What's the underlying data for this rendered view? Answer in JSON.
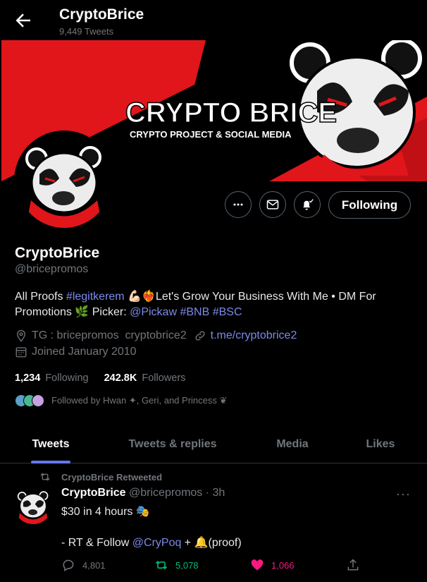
{
  "header": {
    "title": "CryptoBrice",
    "tweet_count": "9,449 Tweets"
  },
  "banner": {
    "headline": "CRYPTO BRICE",
    "tagline": "CRYPTO PROJECT & SOCIAL MEDIA",
    "colors": {
      "red": "#e0161b",
      "black": "#000000"
    }
  },
  "actions": {
    "following_label": "Following"
  },
  "profile": {
    "name": "CryptoBrice",
    "handle": "@bricepromos",
    "bio": {
      "t1": "All Proofs ",
      "tag1": "#legitkerem",
      "t2": " 💪🏻❤️‍🔥Let's Grow Your Business With Me • DM For Promotions 🌿 Picker: ",
      "mention": "@Pickaw",
      "t3": " ",
      "tag2": "#BNB",
      "t4": " ",
      "tag3": "#BSC"
    },
    "location": "TG : bricepromos  cryptobrice2",
    "url": "t.me/cryptobrice2",
    "joined": "Joined January 2010",
    "following_count": "1,234",
    "following_label": "Following",
    "followers_count": "242.8K",
    "followers_label": "Followers",
    "followed_by": "Followed by Hwan ✦, Geri, and Princess ❦"
  },
  "tabs": [
    {
      "label": "Tweets",
      "active": true
    },
    {
      "label": "Tweets & replies",
      "active": false
    },
    {
      "label": "Media",
      "active": false
    },
    {
      "label": "Likes",
      "active": false
    }
  ],
  "tweet": {
    "retweet_note": "CryptoBrice Retweeted",
    "author": "CryptoBrice",
    "handle_time": "@bricepromos · 3h",
    "line1": "$30 in 4 hours 🎭",
    "line2_prefix": "- RT & Follow ",
    "line2_mention": "@CryPoq",
    "line2_suffix": " + 🔔(proof)",
    "replies": "4,801",
    "retweets": "5,078",
    "likes": "1,066"
  },
  "colors": {
    "accent": "#7c8ae8",
    "retweet_green": "#00ba7c",
    "like_pink": "#f91880"
  }
}
